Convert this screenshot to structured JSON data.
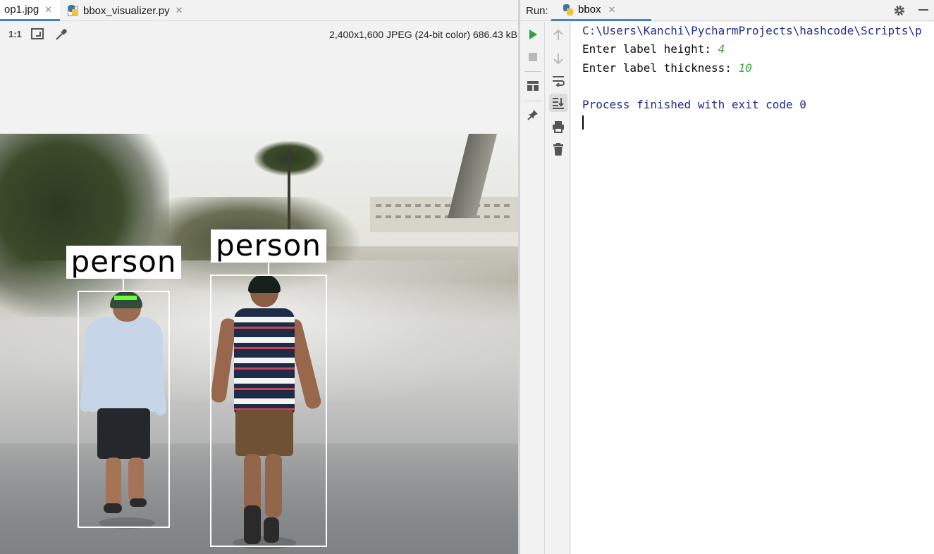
{
  "editor": {
    "tabs": [
      {
        "label": "op1.jpg",
        "active": true
      },
      {
        "label": "bbox_visualizer.py",
        "active": false
      }
    ],
    "toolbar": {
      "actual_size_label": "1:1",
      "image_info": "2,400x1,600 JPEG (24-bit color) 686.43 kB"
    },
    "image": {
      "labels": [
        "person",
        "person"
      ]
    }
  },
  "run": {
    "title": "Run:",
    "tab_label": "bbox",
    "console": {
      "path_line": "C:\\Users\\Kanchi\\PycharmProjects\\hashcode\\Scripts\\p",
      "prompt1": "Enter label height: ",
      "input1": "4",
      "prompt2": "Enter label thickness: ",
      "input2": "10",
      "exit_line": "Process finished with exit code 0"
    }
  },
  "colors": {
    "accent": "#4083c9",
    "console_path": "#1f2b8f",
    "console_input": "#39a535",
    "run_green": "#2ea043"
  }
}
